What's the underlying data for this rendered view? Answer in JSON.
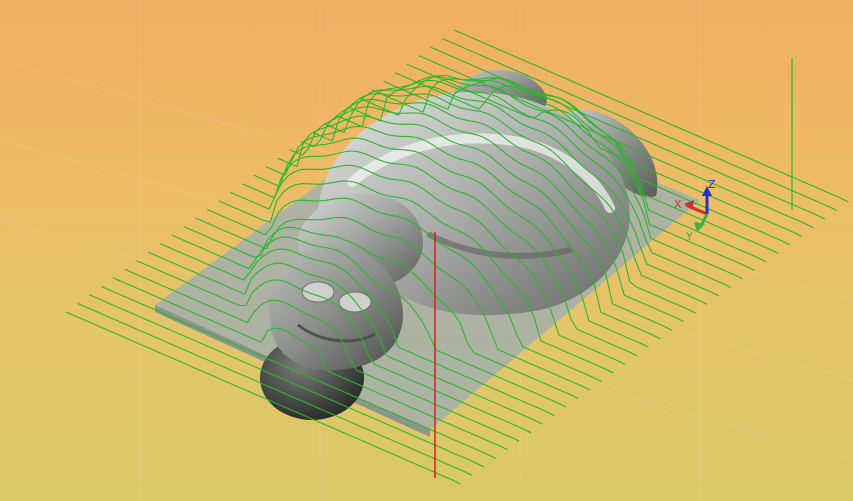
{
  "viewport": {
    "background_top_color": "#f2ad63",
    "background_bottom_color": "#d9c868",
    "toolpath_color": "#2db52d",
    "model_color": "#9a9a9a",
    "stock_color": "#a6b0a8",
    "section_line_color": "#d42020"
  },
  "triad": {
    "x_label": "X",
    "y_label": "Y",
    "z_label": "Z",
    "x_color": "#c83232",
    "y_color": "#3cb43c",
    "z_color": "#2233cc"
  }
}
